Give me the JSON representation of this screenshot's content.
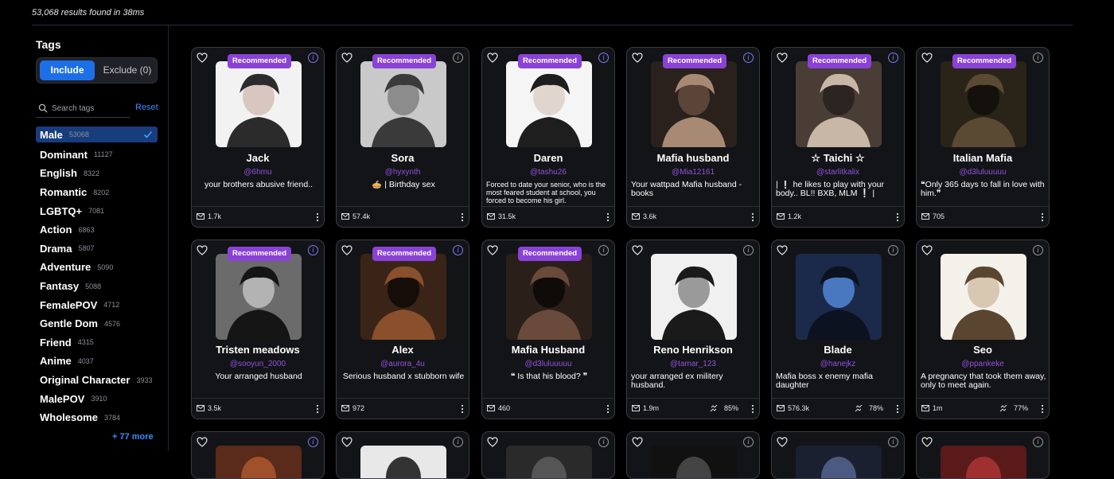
{
  "results_text": "53,068 results found in 38ms",
  "sidebar": {
    "title": "Tags",
    "include_label": "Include",
    "exclude_label": "Exclude (0)",
    "search_placeholder": "Search tags",
    "reset_label": "Reset",
    "more_label": "+ 77 more",
    "tags": [
      {
        "name": "Male",
        "count": "53068",
        "active": true
      },
      {
        "name": "Dominant",
        "count": "11127"
      },
      {
        "name": "English",
        "count": "8322"
      },
      {
        "name": "Romantic",
        "count": "8202"
      },
      {
        "name": "LGBTQ+",
        "count": "7081"
      },
      {
        "name": "Action",
        "count": "6863"
      },
      {
        "name": "Drama",
        "count": "5807"
      },
      {
        "name": "Adventure",
        "count": "5090"
      },
      {
        "name": "Fantasy",
        "count": "5088"
      },
      {
        "name": "FemalePOV",
        "count": "4712"
      },
      {
        "name": "Gentle Dom",
        "count": "4576"
      },
      {
        "name": "Friend",
        "count": "4315"
      },
      {
        "name": "Anime",
        "count": "4037"
      },
      {
        "name": "Original Character",
        "count": "3933"
      },
      {
        "name": "MalePOV",
        "count": "3910"
      },
      {
        "name": "Wholesome",
        "count": "3784"
      }
    ]
  },
  "badge_label": "Recommended",
  "cards": [
    {
      "name": "Jack",
      "handle": "@6hmu",
      "desc": "your brothers abusive friend..",
      "desc_style": "center",
      "count": "1.7k",
      "pct": "",
      "recommended": true,
      "info_blue": true,
      "avatar_colors": [
        "#f2f2f2",
        "#2b2b2b",
        "#d9c6c0"
      ]
    },
    {
      "name": "Sora",
      "handle": "@hyxynth",
      "desc": "🥧 | Birthday sex",
      "desc_style": "center",
      "count": "57.4k",
      "pct": "",
      "recommended": true,
      "info_blue": false,
      "avatar_colors": [
        "#c9c9c9",
        "#3a3a3a",
        "#8c8c8c"
      ]
    },
    {
      "name": "Daren",
      "handle": "@tashu26",
      "desc": "Forced to date your senior, who is the most feared student at school, you forced to become his girl.",
      "desc_style": "small",
      "count": "31.5k",
      "pct": "",
      "recommended": true,
      "info_blue": true,
      "avatar_colors": [
        "#f5f5f5",
        "#1e1e1e",
        "#e0d6cf"
      ]
    },
    {
      "name": "Mafia husband",
      "handle": "@Mia12161",
      "desc": "Your wattpad Mafia husband - books",
      "desc_style": "left",
      "count": "3.6k",
      "pct": "",
      "recommended": true,
      "info_blue": true,
      "avatar_colors": [
        "#2a211c",
        "#a88a74",
        "#5a4538"
      ]
    },
    {
      "name": "☆ Taichi ☆",
      "handle": "@starlitkalix",
      "desc": "| ❕ he likes to play with your body.. BL!! BXB, MLM ❕ |",
      "desc_style": "left",
      "count": "1.2k",
      "pct": "",
      "recommended": true,
      "info_blue": true,
      "avatar_colors": [
        "#4a3d36",
        "#c8b7a6",
        "#2b2420"
      ]
    },
    {
      "name": "Italian Mafia",
      "handle": "@d3luluuuuu",
      "desc": "❝Only 365 days to fall in love with him.❞",
      "desc_style": "left",
      "count": "705",
      "pct": "",
      "recommended": true,
      "info_blue": false,
      "avatar_colors": [
        "#2a2418",
        "#5a4a33",
        "#14110c"
      ]
    },
    {
      "name": "Tristen meadows",
      "handle": "@sooyun_2000",
      "desc": "Your arranged husband",
      "desc_style": "center",
      "count": "3.5k",
      "pct": "",
      "recommended": true,
      "info_blue": true,
      "avatar_colors": [
        "#6b6b6b",
        "#151515",
        "#b3b3b3"
      ]
    },
    {
      "name": "Alex",
      "handle": "@aurora_4u",
      "desc": "Serious husband x stubborn wife",
      "desc_style": "center",
      "count": "972",
      "pct": "",
      "recommended": true,
      "info_blue": true,
      "avatar_colors": [
        "#3a2417",
        "#8a4f2b",
        "#150d08"
      ]
    },
    {
      "name": "Mafia Husband",
      "handle": "@d3luluuuuu",
      "desc": "❝ Is that his blood? ❞",
      "desc_style": "center",
      "count": "460",
      "pct": "",
      "recommended": true,
      "info_blue": false,
      "avatar_colors": [
        "#2b1f1a",
        "#6a4a3a",
        "#0f0b09"
      ]
    },
    {
      "name": "Reno Henrikson",
      "handle": "@tamar_123",
      "desc": "your arranged ex militery husband.",
      "desc_style": "left",
      "count": "1.9m",
      "pct": "85%",
      "recommended": false,
      "info_blue": false,
      "avatar_colors": [
        "#f0f0f0",
        "#1a1a1a",
        "#9a9a9a"
      ]
    },
    {
      "name": "Blade",
      "handle": "@hanejkz",
      "desc": "Mafia boss x enemy mafia daughter",
      "desc_style": "left",
      "count": "576.3k",
      "pct": "78%",
      "recommended": false,
      "info_blue": false,
      "avatar_colors": [
        "#1b2a4a",
        "#0c1220",
        "#4a78c0"
      ]
    },
    {
      "name": "Seo",
      "handle": "@ppankeke",
      "desc": "A pregnancy that took them away, only to meet again.",
      "desc_style": "left",
      "count": "1m",
      "pct": "77%",
      "recommended": false,
      "info_blue": false,
      "avatar_colors": [
        "#f4f1ea",
        "#5a4630",
        "#d8c7b1"
      ]
    }
  ],
  "partial_row": [
    {
      "info_blue": true,
      "avatar_colors": [
        "#5a2a1a",
        "#a0502a"
      ]
    },
    {
      "info_blue": false,
      "avatar_colors": [
        "#e8e8e8",
        "#333"
      ]
    },
    {
      "info_blue": false,
      "avatar_colors": [
        "#2a2a2a",
        "#555"
      ]
    },
    {
      "info_blue": false,
      "avatar_colors": [
        "#111",
        "#444"
      ]
    },
    {
      "info_blue": false,
      "avatar_colors": [
        "#1a2030",
        "#4a5a80"
      ]
    },
    {
      "info_blue": false,
      "avatar_colors": [
        "#5a1a1a",
        "#a03030"
      ]
    }
  ]
}
